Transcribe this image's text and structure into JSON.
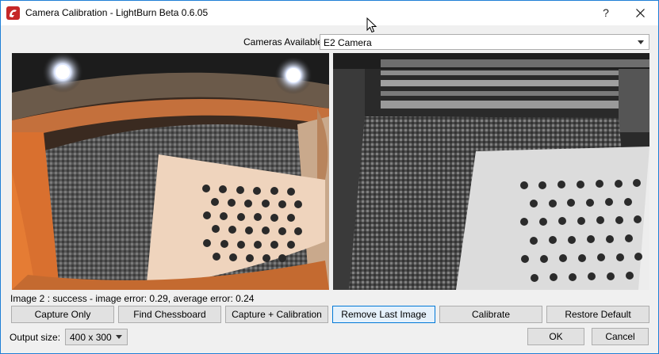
{
  "window": {
    "title": "Camera Calibration - LightBurn Beta 0.6.05",
    "help_label": "?"
  },
  "cameras": {
    "label": "Cameras Available:",
    "selected": "E2 Camera"
  },
  "status_text": "Image 2 : success - image error: 0.29, average error: 0.24",
  "actions": {
    "capture_only": "Capture Only",
    "find_chessboard": "Find Chessboard",
    "capture_calibration": "Capture + Calibration",
    "remove_last": "Remove Last Image",
    "calibrate": "Calibrate",
    "restore_default": "Restore Default"
  },
  "output": {
    "label": "Output size:",
    "selected": "400 x 300"
  },
  "dialog": {
    "ok": "OK",
    "cancel": "Cancel"
  },
  "colors": {
    "accent": "#0078d7",
    "app_icon": "#c62828"
  }
}
